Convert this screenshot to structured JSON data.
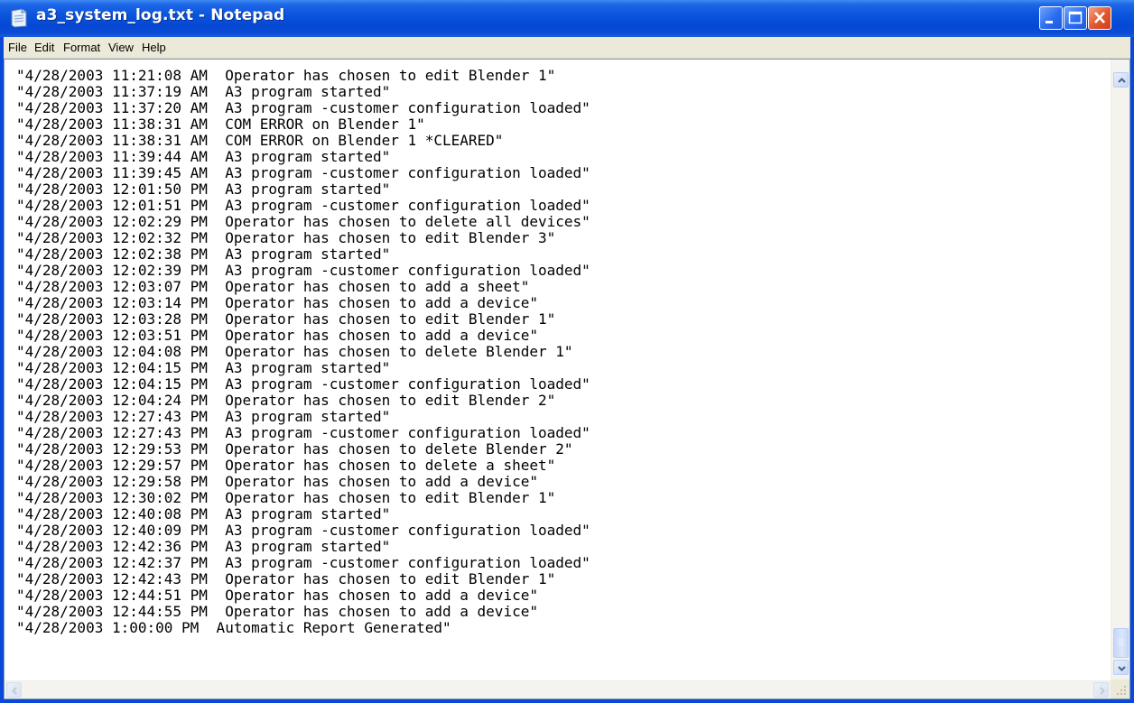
{
  "window": {
    "title": "a3_system_log.txt - Notepad",
    "icon": "notepad-icon",
    "accent": "#0a55dc",
    "close_color": "#e2552a"
  },
  "menu": {
    "items": [
      "File",
      "Edit",
      "Format",
      "View",
      "Help"
    ]
  },
  "document": {
    "lines": [
      "\"4/28/2003 11:21:08 AM  Operator has chosen to edit Blender 1\"",
      "\"4/28/2003 11:37:19 AM  A3 program started\"",
      "\"4/28/2003 11:37:20 AM  A3 program -customer configuration loaded\"",
      "\"4/28/2003 11:38:31 AM  COM ERROR on Blender 1\"",
      "\"4/28/2003 11:38:31 AM  COM ERROR on Blender 1 *CLEARED\"",
      "\"4/28/2003 11:39:44 AM  A3 program started\"",
      "\"4/28/2003 11:39:45 AM  A3 program -customer configuration loaded\"",
      "\"4/28/2003 12:01:50 PM  A3 program started\"",
      "\"4/28/2003 12:01:51 PM  A3 program -customer configuration loaded\"",
      "\"4/28/2003 12:02:29 PM  Operator has chosen to delete all devices\"",
      "\"4/28/2003 12:02:32 PM  Operator has chosen to edit Blender 3\"",
      "\"4/28/2003 12:02:38 PM  A3 program started\"",
      "\"4/28/2003 12:02:39 PM  A3 program -customer configuration loaded\"",
      "\"4/28/2003 12:03:07 PM  Operator has chosen to add a sheet\"",
      "\"4/28/2003 12:03:14 PM  Operator has chosen to add a device\"",
      "\"4/28/2003 12:03:28 PM  Operator has chosen to edit Blender 1\"",
      "\"4/28/2003 12:03:51 PM  Operator has chosen to add a device\"",
      "\"4/28/2003 12:04:08 PM  Operator has chosen to delete Blender 1\"",
      "\"4/28/2003 12:04:15 PM  A3 program started\"",
      "\"4/28/2003 12:04:15 PM  A3 program -customer configuration loaded\"",
      "\"4/28/2003 12:04:24 PM  Operator has chosen to edit Blender 2\"",
      "\"4/28/2003 12:27:43 PM  A3 program started\"",
      "\"4/28/2003 12:27:43 PM  A3 program -customer configuration loaded\"",
      "\"4/28/2003 12:29:53 PM  Operator has chosen to delete Blender 2\"",
      "\"4/28/2003 12:29:57 PM  Operator has chosen to delete a sheet\"",
      "\"4/28/2003 12:29:58 PM  Operator has chosen to add a device\"",
      "\"4/28/2003 12:30:02 PM  Operator has chosen to edit Blender 1\"",
      "\"4/28/2003 12:40:08 PM  A3 program started\"",
      "\"4/28/2003 12:40:09 PM  A3 program -customer configuration loaded\"",
      "\"4/28/2003 12:42:36 PM  A3 program started\"",
      "\"4/28/2003 12:42:37 PM  A3 program -customer configuration loaded\"",
      "\"4/28/2003 12:42:43 PM  Operator has chosen to edit Blender 1\"",
      "\"4/28/2003 12:44:51 PM  Operator has chosen to add a device\"",
      "\"4/28/2003 12:44:55 PM  Operator has chosen to add a device\"",
      "\"4/28/2003 1:00:00 PM  Automatic Report Generated\""
    ]
  },
  "controls": {
    "minimize_icon": "minimize-icon",
    "maximize_icon": "maximize-icon",
    "close_icon": "close-icon"
  }
}
